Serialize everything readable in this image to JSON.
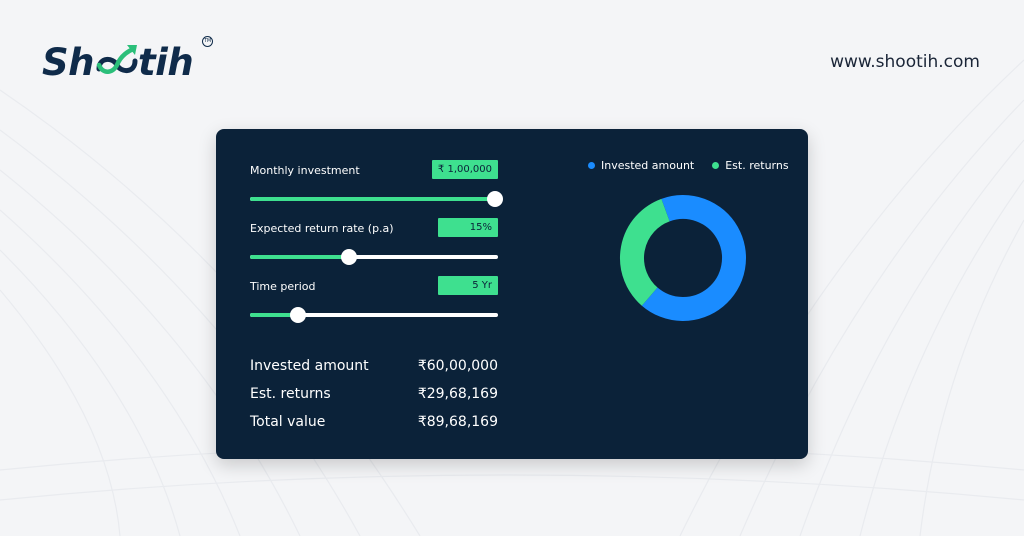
{
  "brand": {
    "name_prefix": "Sh",
    "name_suffix": "tih",
    "website": "www.shootih.com",
    "color": "#0f2b4a",
    "accent": "#2bbf7a"
  },
  "calculator": {
    "monthly_investment": {
      "label": "Monthly investment",
      "value": "₹ 1,00,000",
      "slider_fraction": 0.988
    },
    "return_rate": {
      "label": "Expected return rate (p.a)",
      "value": "15%",
      "slider_fraction": 0.4
    },
    "time_period": {
      "label": "Time period",
      "value": "5 Yr",
      "slider_fraction": 0.195
    },
    "summary": {
      "invested_label": "Invested amount",
      "invested_value": "₹60,00,000",
      "returns_label": "Est. returns",
      "returns_value": "₹29,68,169",
      "total_label": "Total value",
      "total_value": "₹89,68,169"
    }
  },
  "legend": {
    "invested": "Invested amount",
    "returns": "Est. returns"
  },
  "chart_data": {
    "type": "pie",
    "categories": [
      "Invested amount",
      "Est. returns"
    ],
    "values": [
      6000000,
      2968169
    ],
    "colors": [
      "#1a8cff",
      "#3ee08f"
    ],
    "legend": "top-right"
  },
  "colors": {
    "card_bg": "#0b2239",
    "green": "#3ee08f",
    "blue": "#1a8cff"
  }
}
